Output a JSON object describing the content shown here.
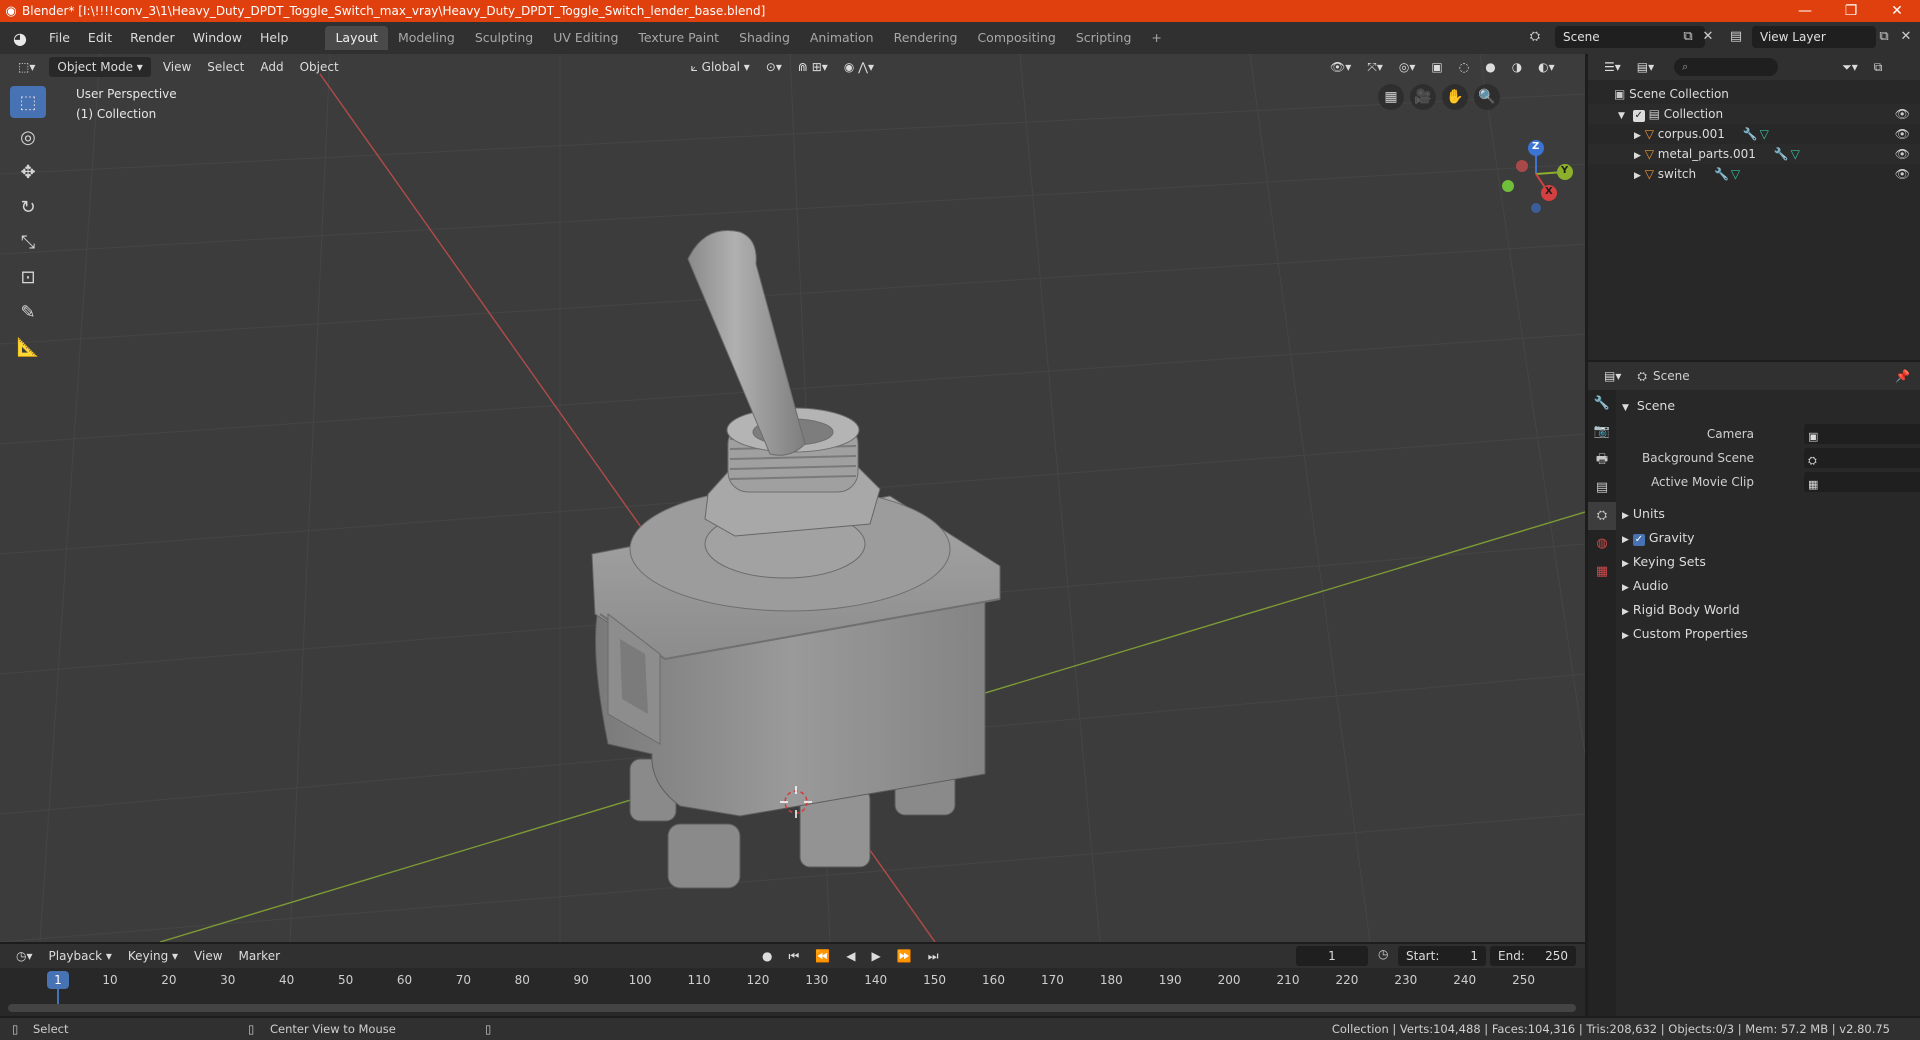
{
  "window": {
    "title": "Blender* [I:\\!!!!conv_3\\1\\Heavy_Duty_DPDT_Toggle_Switch_max_vray\\Heavy_Duty_DPDT_Toggle_Switch_lender_base.blend]",
    "min_symbol": "—",
    "max_symbol": "❐",
    "close_symbol": "✕"
  },
  "menu": [
    "File",
    "Edit",
    "Render",
    "Window",
    "Help"
  ],
  "workspaces": [
    "Layout",
    "Modeling",
    "Sculpting",
    "UV Editing",
    "Texture Paint",
    "Shading",
    "Animation",
    "Rendering",
    "Compositing",
    "Scripting"
  ],
  "active_workspace": "Layout",
  "scene_selector": {
    "value": "Scene"
  },
  "view_layer_selector": {
    "value": "View Layer"
  },
  "viewport": {
    "mode": "Object Mode",
    "menus": [
      "View",
      "Select",
      "Add",
      "Object"
    ],
    "orientation": "Global",
    "info_line1": "User Perspective",
    "info_line2": "(1) Collection",
    "axes": {
      "x": "X",
      "y": "Y",
      "z": "Z"
    }
  },
  "outliner": {
    "root": "Scene Collection",
    "collection": "Collection",
    "objects": [
      "corpus.001",
      "metal_parts.001",
      "switch"
    ]
  },
  "properties": {
    "header": "Scene",
    "panel_title": "Scene",
    "camera_label": "Camera",
    "background_scene_label": "Background Scene",
    "active_movie_clip_label": "Active Movie Clip",
    "sections": [
      "Units",
      "Gravity",
      "Keying Sets",
      "Audio",
      "Rigid Body World",
      "Custom Properties"
    ],
    "gravity_checked": true
  },
  "timeline": {
    "menus": [
      "Playback",
      "Keying",
      "View",
      "Marker"
    ],
    "current_frame": "1",
    "start_label": "Start:",
    "start_value": "1",
    "end_label": "End:",
    "end_value": "250",
    "frame_marks": [
      "10",
      "20",
      "30",
      "40",
      "50",
      "60",
      "70",
      "80",
      "90",
      "100",
      "110",
      "120",
      "130",
      "140",
      "150",
      "160",
      "170",
      "180",
      "190",
      "200",
      "210",
      "220",
      "230",
      "240",
      "250"
    ]
  },
  "statusbar": {
    "select": "Select",
    "center_view": "Center View to Mouse",
    "stats": "Collection | Verts:104,488 | Faces:104,316 | Tris:208,632 | Objects:0/3 | Mem: 57.2 MB | v2.80.75"
  }
}
